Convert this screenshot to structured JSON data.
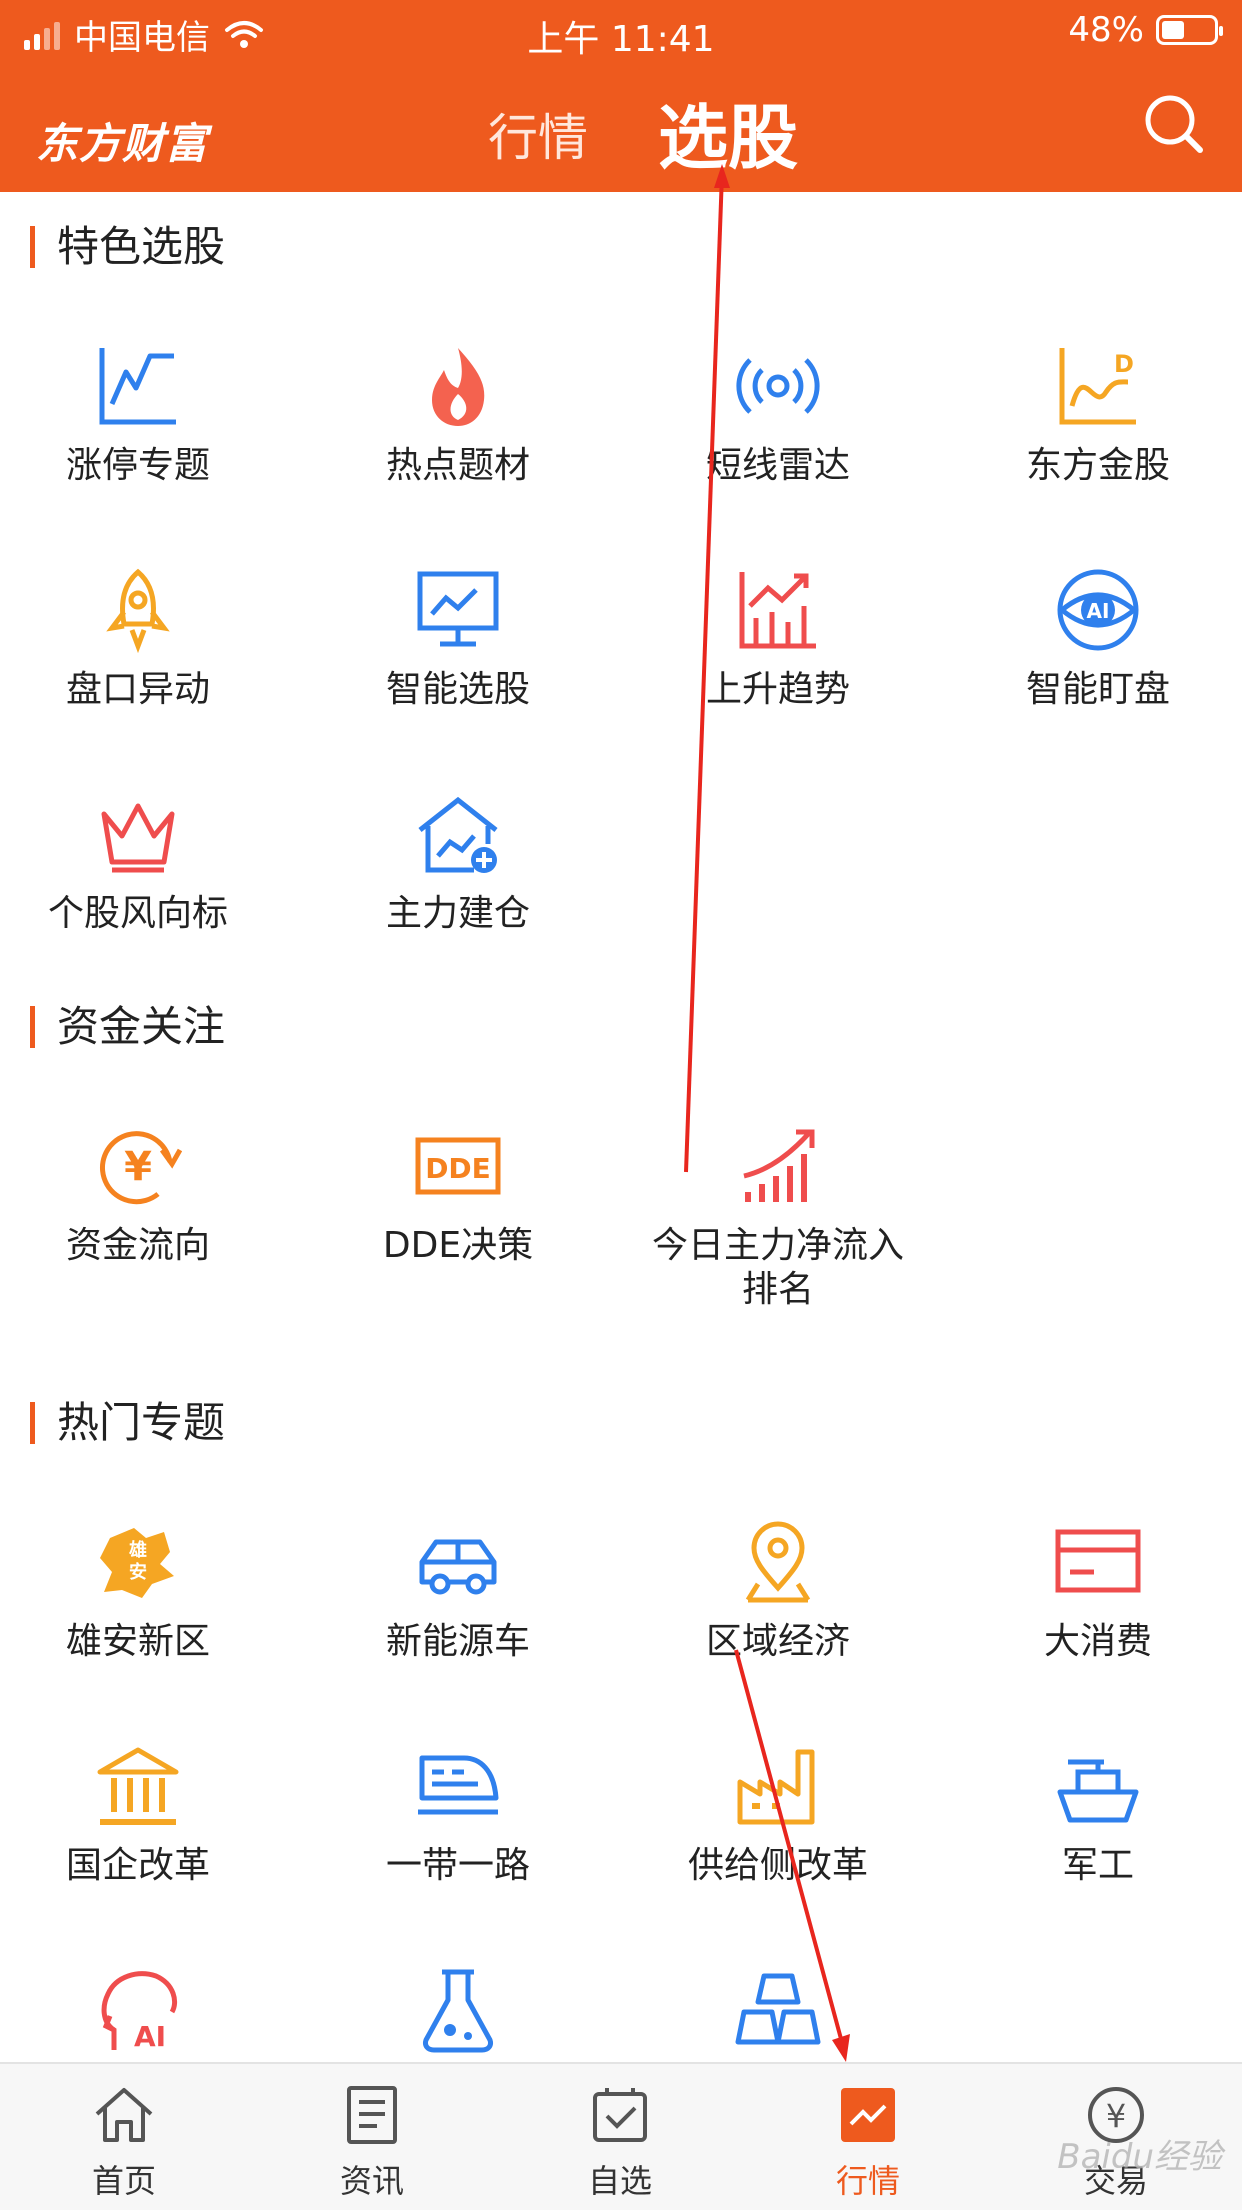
{
  "status": {
    "carrier": "中国电信",
    "time": "上午 11:41",
    "battery": "48%",
    "battery_level": 0.48
  },
  "header": {
    "logo": "东方财富",
    "tabs": [
      "行情",
      "选股"
    ],
    "active_tab": "选股",
    "accent": "#ee5a1e"
  },
  "sections": [
    {
      "title": "特色选股",
      "items": [
        {
          "label": "涨停专题",
          "icon": "limit-up-chart-icon"
        },
        {
          "label": "热点题材",
          "icon": "flame-icon"
        },
        {
          "label": "短线雷达",
          "icon": "radar-icon"
        },
        {
          "label": "东方金股",
          "icon": "gold-stock-chart-icon"
        },
        {
          "label": "盘口异动",
          "icon": "rocket-icon"
        },
        {
          "label": "智能选股",
          "icon": "monitor-chart-icon"
        },
        {
          "label": "上升趋势",
          "icon": "rising-trend-icon"
        },
        {
          "label": "智能盯盘",
          "icon": "ai-eye-icon"
        },
        {
          "label": "个股风向标",
          "icon": "crown-icon"
        },
        {
          "label": "主力建仓",
          "icon": "house-plus-icon"
        }
      ]
    },
    {
      "title": "资金关注",
      "items": [
        {
          "label": "资金流向",
          "icon": "yuan-cycle-icon"
        },
        {
          "label": "DDE决策",
          "icon": "dde-icon",
          "icon_text": "DDE"
        },
        {
          "label": "今日主力净流入排名",
          "icon": "bar-growth-icon"
        }
      ]
    },
    {
      "title": "热门专题",
      "items": [
        {
          "label": "雄安新区",
          "icon": "xiongan-map-icon",
          "icon_text": "雄安"
        },
        {
          "label": "新能源车",
          "icon": "car-icon"
        },
        {
          "label": "区域经济",
          "icon": "location-pin-icon"
        },
        {
          "label": "大消费",
          "icon": "card-icon"
        },
        {
          "label": "国企改革",
          "icon": "government-building-icon"
        },
        {
          "label": "一带一路",
          "icon": "train-icon"
        },
        {
          "label": "供给侧改革",
          "icon": "factory-icon"
        },
        {
          "label": "军工",
          "icon": "warship-icon"
        },
        {
          "label": "",
          "icon": "ai-head-icon",
          "icon_text": "AI"
        },
        {
          "label": "",
          "icon": "flask-icon"
        },
        {
          "label": "",
          "icon": "gold-bars-icon"
        }
      ]
    }
  ],
  "tabbar": [
    {
      "label": "首页",
      "icon": "home-icon"
    },
    {
      "label": "资讯",
      "icon": "news-icon"
    },
    {
      "label": "自选",
      "icon": "checkbox-icon"
    },
    {
      "label": "行情",
      "icon": "market-chart-icon",
      "active": true
    },
    {
      "label": "交易",
      "icon": "yuan-circle-icon"
    }
  ],
  "watermark": "Baidu经验"
}
